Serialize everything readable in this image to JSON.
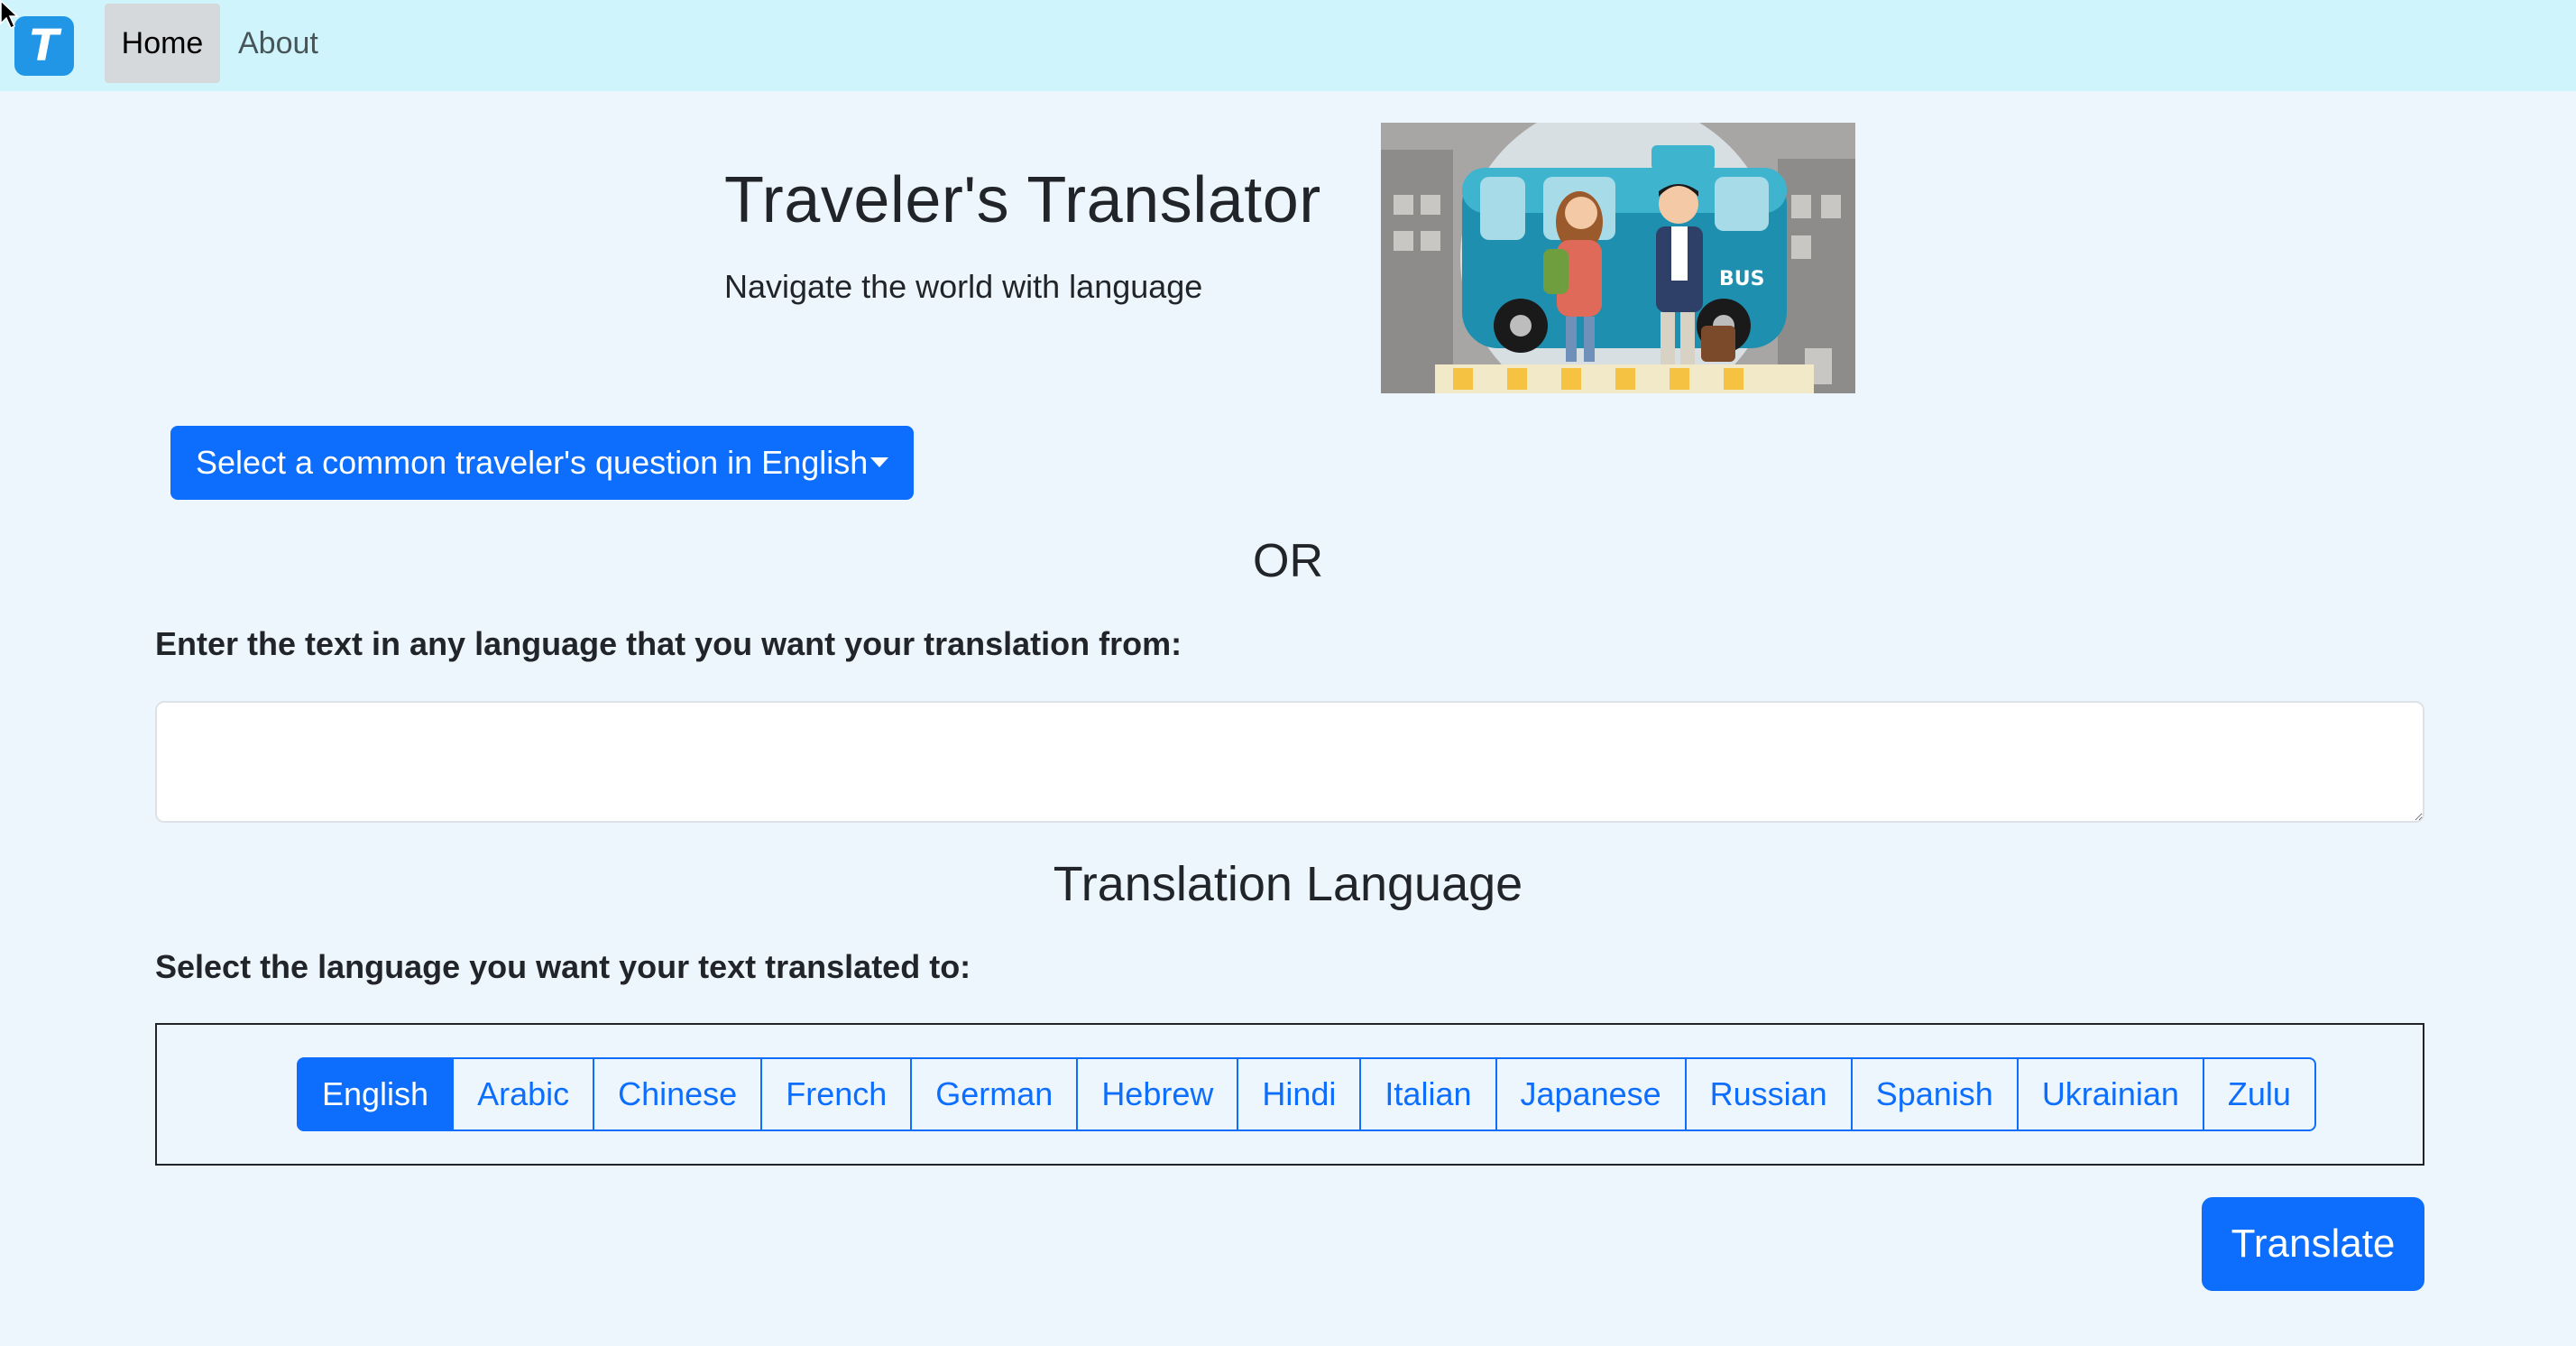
{
  "nav": {
    "logo_letter": "T",
    "items": [
      {
        "label": "Home",
        "active": true
      },
      {
        "label": "About",
        "active": false
      }
    ],
    "background_color": "#cff4fc"
  },
  "header": {
    "title": "Traveler's Translator",
    "subtitle": "Navigate the world with language",
    "image_text": "BUS"
  },
  "question_dropdown": {
    "label": "Select a common traveler's question in English",
    "icon": "caret-down-icon"
  },
  "or_text": "OR",
  "input_section": {
    "label": "Enter the text in any language that you want your translation from:",
    "value": "",
    "placeholder": ""
  },
  "language_section": {
    "heading": "Translation Language",
    "label": "Select the language you want your text translated to:",
    "languages": [
      "English",
      "Arabic",
      "Chinese",
      "French",
      "German",
      "Hebrew",
      "Hindi",
      "Italian",
      "Japanese",
      "Russian",
      "Spanish",
      "Ukrainian",
      "Zulu"
    ],
    "selected": "English"
  },
  "translate_button": {
    "label": "Translate"
  },
  "colors": {
    "primary": "#0d6efd",
    "page_background": "#eef6fd",
    "logo": "#2196e6"
  }
}
